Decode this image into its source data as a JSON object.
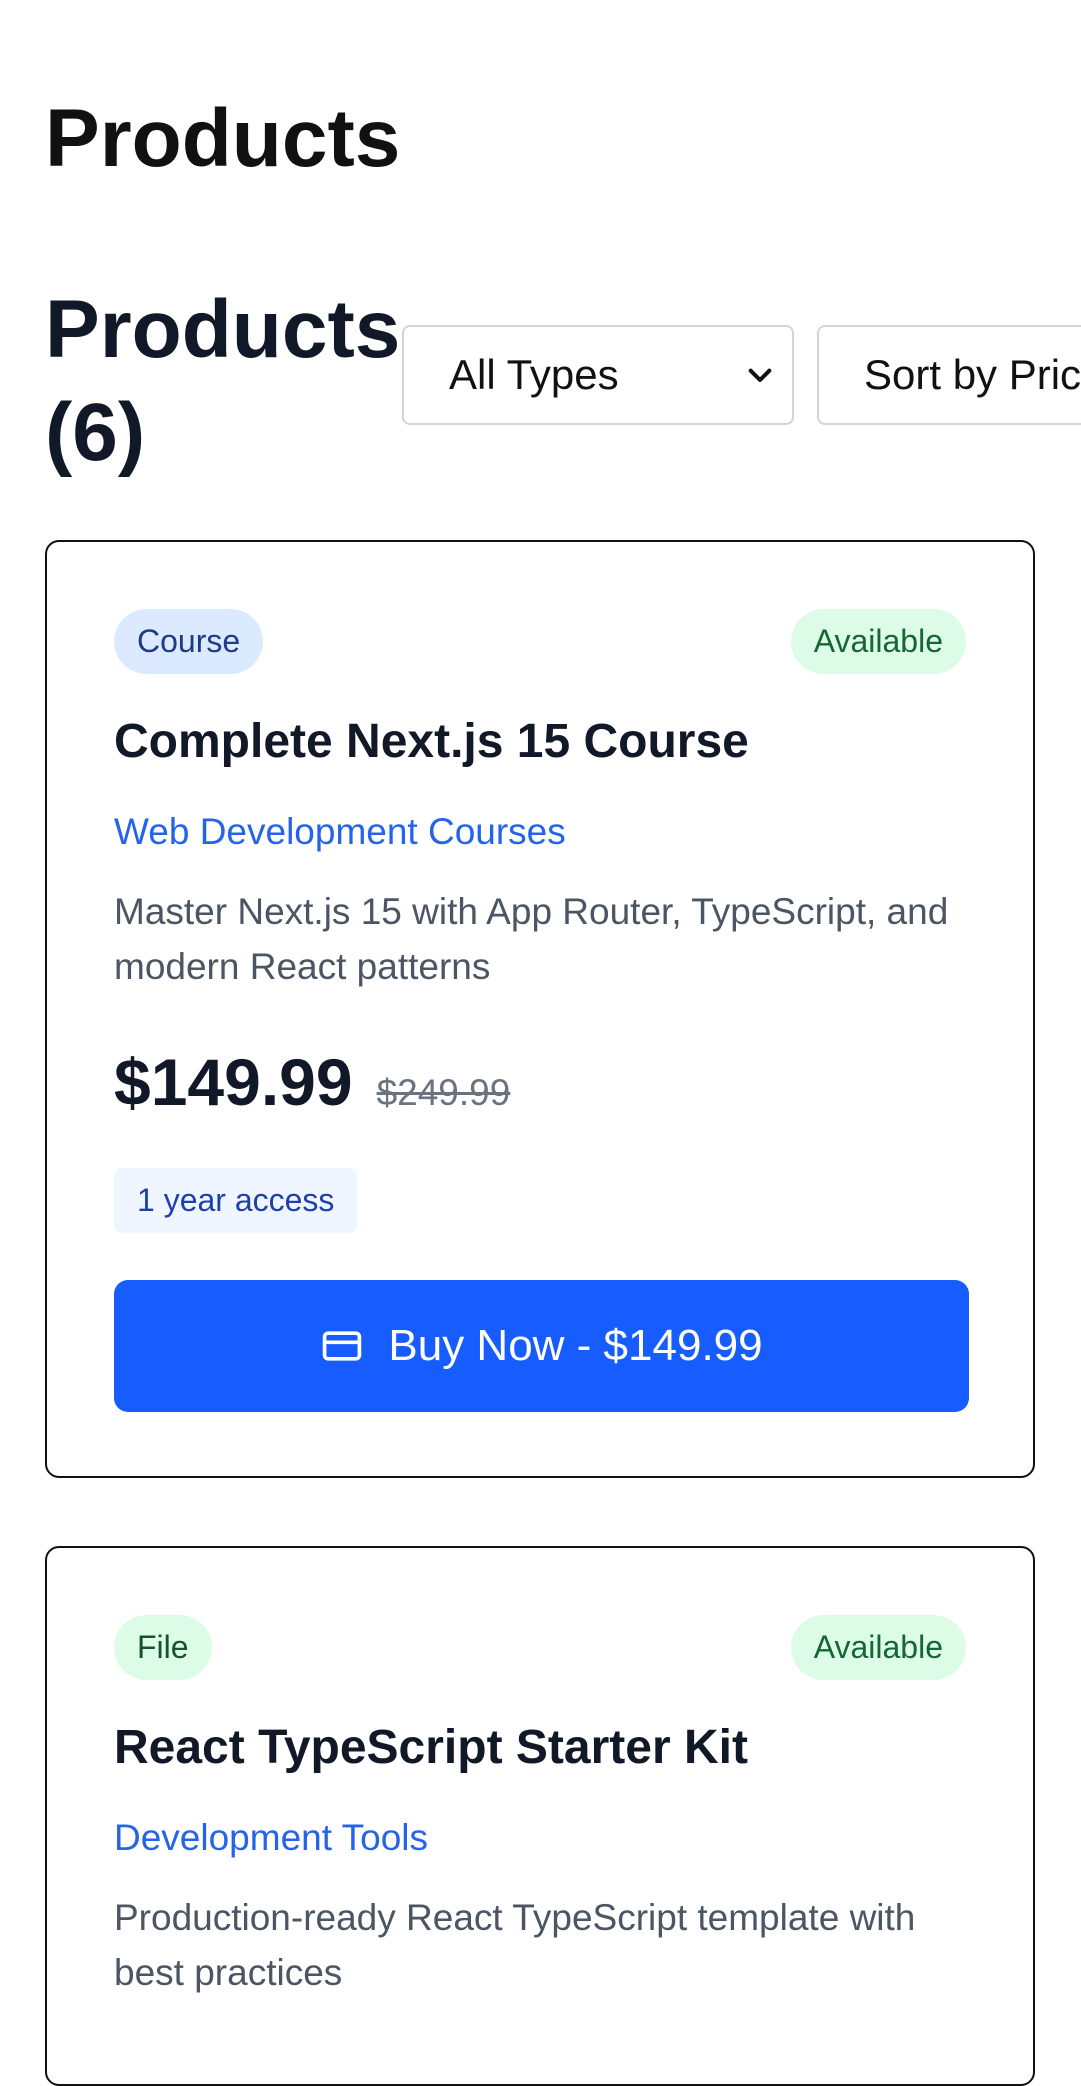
{
  "page": {
    "title": "Products"
  },
  "toolbar": {
    "heading": "Products (6)",
    "type_filter": {
      "selected": "All Types"
    },
    "sort": {
      "selected": "Sort by Pric"
    }
  },
  "icons": {
    "chevron": "chevron-down-icon",
    "buy": "credit-card-icon"
  },
  "colors": {
    "accent": "#175cff",
    "link": "#2563eb",
    "status_available": "#dcfce7"
  },
  "products": [
    {
      "type_badge": "Course",
      "status": "Available",
      "name": "Complete Next.js 15 Course",
      "category": "Web Development Courses",
      "description": "Master Next.js 15 with App Router, TypeScript, and modern React patterns",
      "price": "$149.99",
      "original_price": "$249.99",
      "access": "1 year access",
      "buy_label": "Buy Now - $149.99"
    },
    {
      "type_badge": "File",
      "status": "Available",
      "name": "React TypeScript Starter Kit",
      "category": "Development Tools",
      "description": "Production-ready React TypeScript template with best practices"
    }
  ]
}
